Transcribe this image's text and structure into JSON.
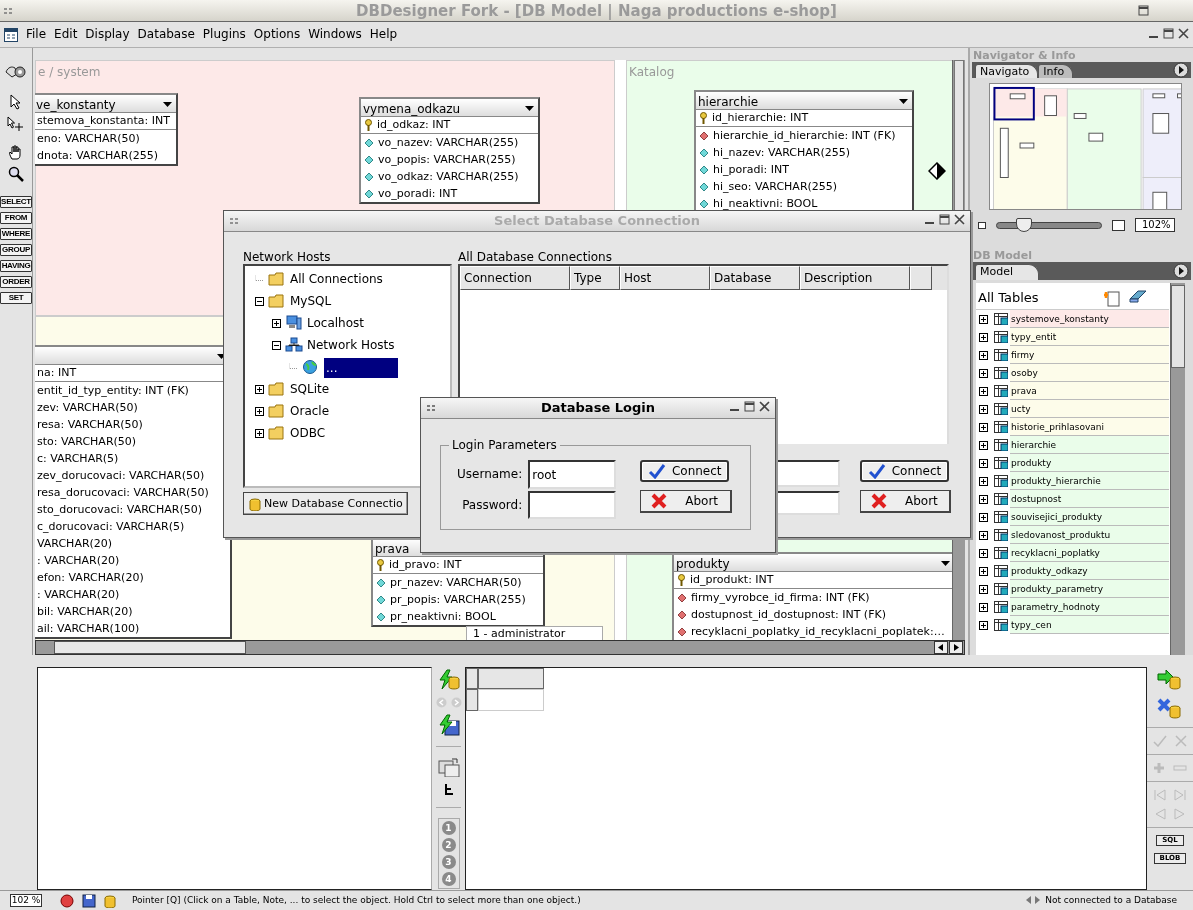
{
  "window": {
    "title": "DBDesigner Fork - [DB Model | Naga productions e-shop]"
  },
  "menu": [
    "File",
    "Edit",
    "Display",
    "Database",
    "Plugins",
    "Options",
    "Windows",
    "Help"
  ],
  "clause_buttons": [
    "SELECT",
    "FROM",
    "WHERE",
    "GROUP",
    "HAVING",
    "ORDER",
    "SET"
  ],
  "canvas": {
    "regions": [
      {
        "label": "e / system",
        "color": "#fde9e8"
      },
      {
        "color": "#fdfcea"
      },
      {
        "label": "Katalog",
        "color": "#eafdea"
      }
    ],
    "tables": [
      {
        "name": "ve_konstanty",
        "columns": [
          {
            "text": "stemova_konstanta: INT",
            "kind": "cut"
          },
          {
            "text": "eno: VARCHAR(50)",
            "kind": "cut"
          },
          {
            "text": "dnota: VARCHAR(255)",
            "kind": "cut"
          }
        ]
      },
      {
        "name": "vymena_odkazu",
        "columns": [
          {
            "text": "id_odkaz: INT",
            "kind": "key"
          },
          {
            "text": "vo_nazev: VARCHAR(255)",
            "kind": "attr"
          },
          {
            "text": "vo_popis: VARCHAR(255)",
            "kind": "attr"
          },
          {
            "text": "vo_odkaz: VARCHAR(255)",
            "kind": "attr"
          },
          {
            "text": "vo_poradi: INT",
            "kind": "attr"
          }
        ]
      },
      {
        "name": "hierarchie",
        "columns": [
          {
            "text": "id_hierarchie: INT",
            "kind": "key"
          },
          {
            "text": "hierarchie_id_hierarchie: INT (FK)",
            "kind": "fk"
          },
          {
            "text": "hi_nazev: VARCHAR(255)",
            "kind": "attr"
          },
          {
            "text": "hi_poradi: INT",
            "kind": "attr"
          },
          {
            "text": "hi_seo: VARCHAR(255)",
            "kind": "attr"
          },
          {
            "text": "hi_neaktivni: BOOL",
            "kind": "attr"
          }
        ]
      },
      {
        "columns": [
          {
            "text": "na: INT",
            "kind": "cut"
          },
          {
            "text": "entit_id_typ_entity: INT (FK)",
            "kind": "cut"
          },
          {
            "text": "zev: VARCHAR(50)",
            "kind": "cut"
          },
          {
            "text": "resa: VARCHAR(50)",
            "kind": "cut"
          },
          {
            "text": "sto: VARCHAR(50)",
            "kind": "cut"
          },
          {
            "text": "c: VARCHAR(5)",
            "kind": "cut"
          },
          {
            "text": "zev_dorucovaci: VARCHAR(50)",
            "kind": "cut"
          },
          {
            "text": "resa_dorucovaci: VARCHAR(50)",
            "kind": "cut"
          },
          {
            "text": "sto_dorucovaci: VARCHAR(50)",
            "kind": "cut"
          },
          {
            "text": "c_dorucovaci: VARCHAR(5)",
            "kind": "cut"
          },
          {
            "text": "VARCHAR(20)",
            "kind": "cut"
          },
          {
            "text": ": VARCHAR(20)",
            "kind": "cut"
          },
          {
            "text": "efon: VARCHAR(20)",
            "kind": "cut"
          },
          {
            "text": ": VARCHAR(20)",
            "kind": "cut"
          },
          {
            "text": "bil: VARCHAR(20)",
            "kind": "cut"
          },
          {
            "text": "ail: VARCHAR(100)",
            "kind": "cut"
          }
        ]
      },
      {
        "name": "prava",
        "columns": [
          {
            "text": "id_pravo: INT",
            "kind": "key"
          },
          {
            "text": "pr_nazev: VARCHAR(50)",
            "kind": "attr"
          },
          {
            "text": "pr_popis: VARCHAR(255)",
            "kind": "attr"
          },
          {
            "text": "pr_neaktivni: BOOL",
            "kind": "attr"
          }
        ]
      },
      {
        "name": "produkty",
        "columns": [
          {
            "text": "id_produkt: INT",
            "kind": "key"
          },
          {
            "text": "firmy_vyrobce_id_firma: INT (FK)",
            "kind": "fk"
          },
          {
            "text": "dostupnost_id_dostupnost: INT (FK)",
            "kind": "fk"
          },
          {
            "text": "recyklacni_poplatky_id_recyklacni_poplatek:…",
            "kind": "fk"
          }
        ]
      }
    ],
    "notes": [
      "1 - administrator"
    ]
  },
  "navigator": {
    "title": "Navigator & Info",
    "tabs": [
      {
        "label": "Navigato",
        "selected": true
      },
      {
        "label": "Info",
        "selected": false
      }
    ],
    "zoom": {
      "level": 0.26
    },
    "zoom_reading": "102%"
  },
  "model": {
    "title": "DB Model",
    "tabs": [
      {
        "label": "Model",
        "selected": true
      }
    ],
    "heading": "All Tables",
    "tables": [
      {
        "name": "systemove_konstanty",
        "color": "#fde9e8"
      },
      {
        "name": "typy_entit",
        "color": "#fdfcea"
      },
      {
        "name": "firmy",
        "color": "#fdfcea"
      },
      {
        "name": "osoby",
        "color": "#fdfcea"
      },
      {
        "name": "prava",
        "color": "#fdfcea"
      },
      {
        "name": "ucty",
        "color": "#fdfcea"
      },
      {
        "name": "historie_prihlasovani",
        "color": "#fdfcea"
      },
      {
        "name": "hierarchie",
        "color": "#eafdea"
      },
      {
        "name": "produkty",
        "color": "#eafdea"
      },
      {
        "name": "produkty_hierarchie",
        "color": "#eafdea"
      },
      {
        "name": "dostupnost",
        "color": "#eafdea"
      },
      {
        "name": "souvisejici_produkty",
        "color": "#eafdea"
      },
      {
        "name": "sledovanost_produktu",
        "color": "#eafdea"
      },
      {
        "name": "recyklacni_poplatky",
        "color": "#eafdea"
      },
      {
        "name": "produkty_odkazy",
        "color": "#eafdea"
      },
      {
        "name": "produkty_parametry",
        "color": "#eafdea"
      },
      {
        "name": "parametry_hodnoty",
        "color": "#eafdea"
      },
      {
        "name": "typy_cen",
        "color": "#eafdea"
      }
    ]
  },
  "query": {
    "history_slots": [
      "1",
      "2",
      "3",
      "4"
    ],
    "buttons": [
      "SQL",
      "BLOB"
    ]
  },
  "connection_dialog": {
    "title": "Select Database Connection",
    "hosts_label": "Network Hosts",
    "tree": [
      {
        "label": "All Connections",
        "kind": "folder",
        "selected": false
      },
      {
        "label": "MySQL",
        "kind": "folder",
        "expanded": true,
        "selected": false,
        "children": [
          {
            "label": "Localhost",
            "kind": "server",
            "expanded": false,
            "selected": false
          },
          {
            "label": "Network Hosts",
            "kind": "network",
            "expanded": true,
            "selected": false,
            "children": [
              {
                "label": "...",
                "kind": "globe",
                "selected": true
              }
            ]
          }
        ]
      },
      {
        "label": "SQLite",
        "kind": "folder",
        "expanded": false,
        "selected": false
      },
      {
        "label": "Oracle",
        "kind": "folder",
        "expanded": false,
        "selected": false
      },
      {
        "label": "ODBC",
        "kind": "folder",
        "expanded": false,
        "selected": false
      }
    ],
    "new_button": "New Database Connectio",
    "connections_label": "All Database Connections",
    "columns": [
      "Connection",
      "Type",
      "Host",
      "Database",
      "Description"
    ],
    "connect": "Connect",
    "abort": "Abort"
  },
  "login_dialog": {
    "title": "Database Login",
    "group": "Login Parameters",
    "username_label": "Username:",
    "username": "root",
    "password_label": "Password:",
    "connect": "Connect",
    "abort": "Abort"
  },
  "status_bar": {
    "zoom": "102 %",
    "message": "Pointer [Q] (Click on a Table, Note, ... to select the object. Hold Ctrl to select more than one object.)",
    "connection": "Not connected to a Database"
  }
}
